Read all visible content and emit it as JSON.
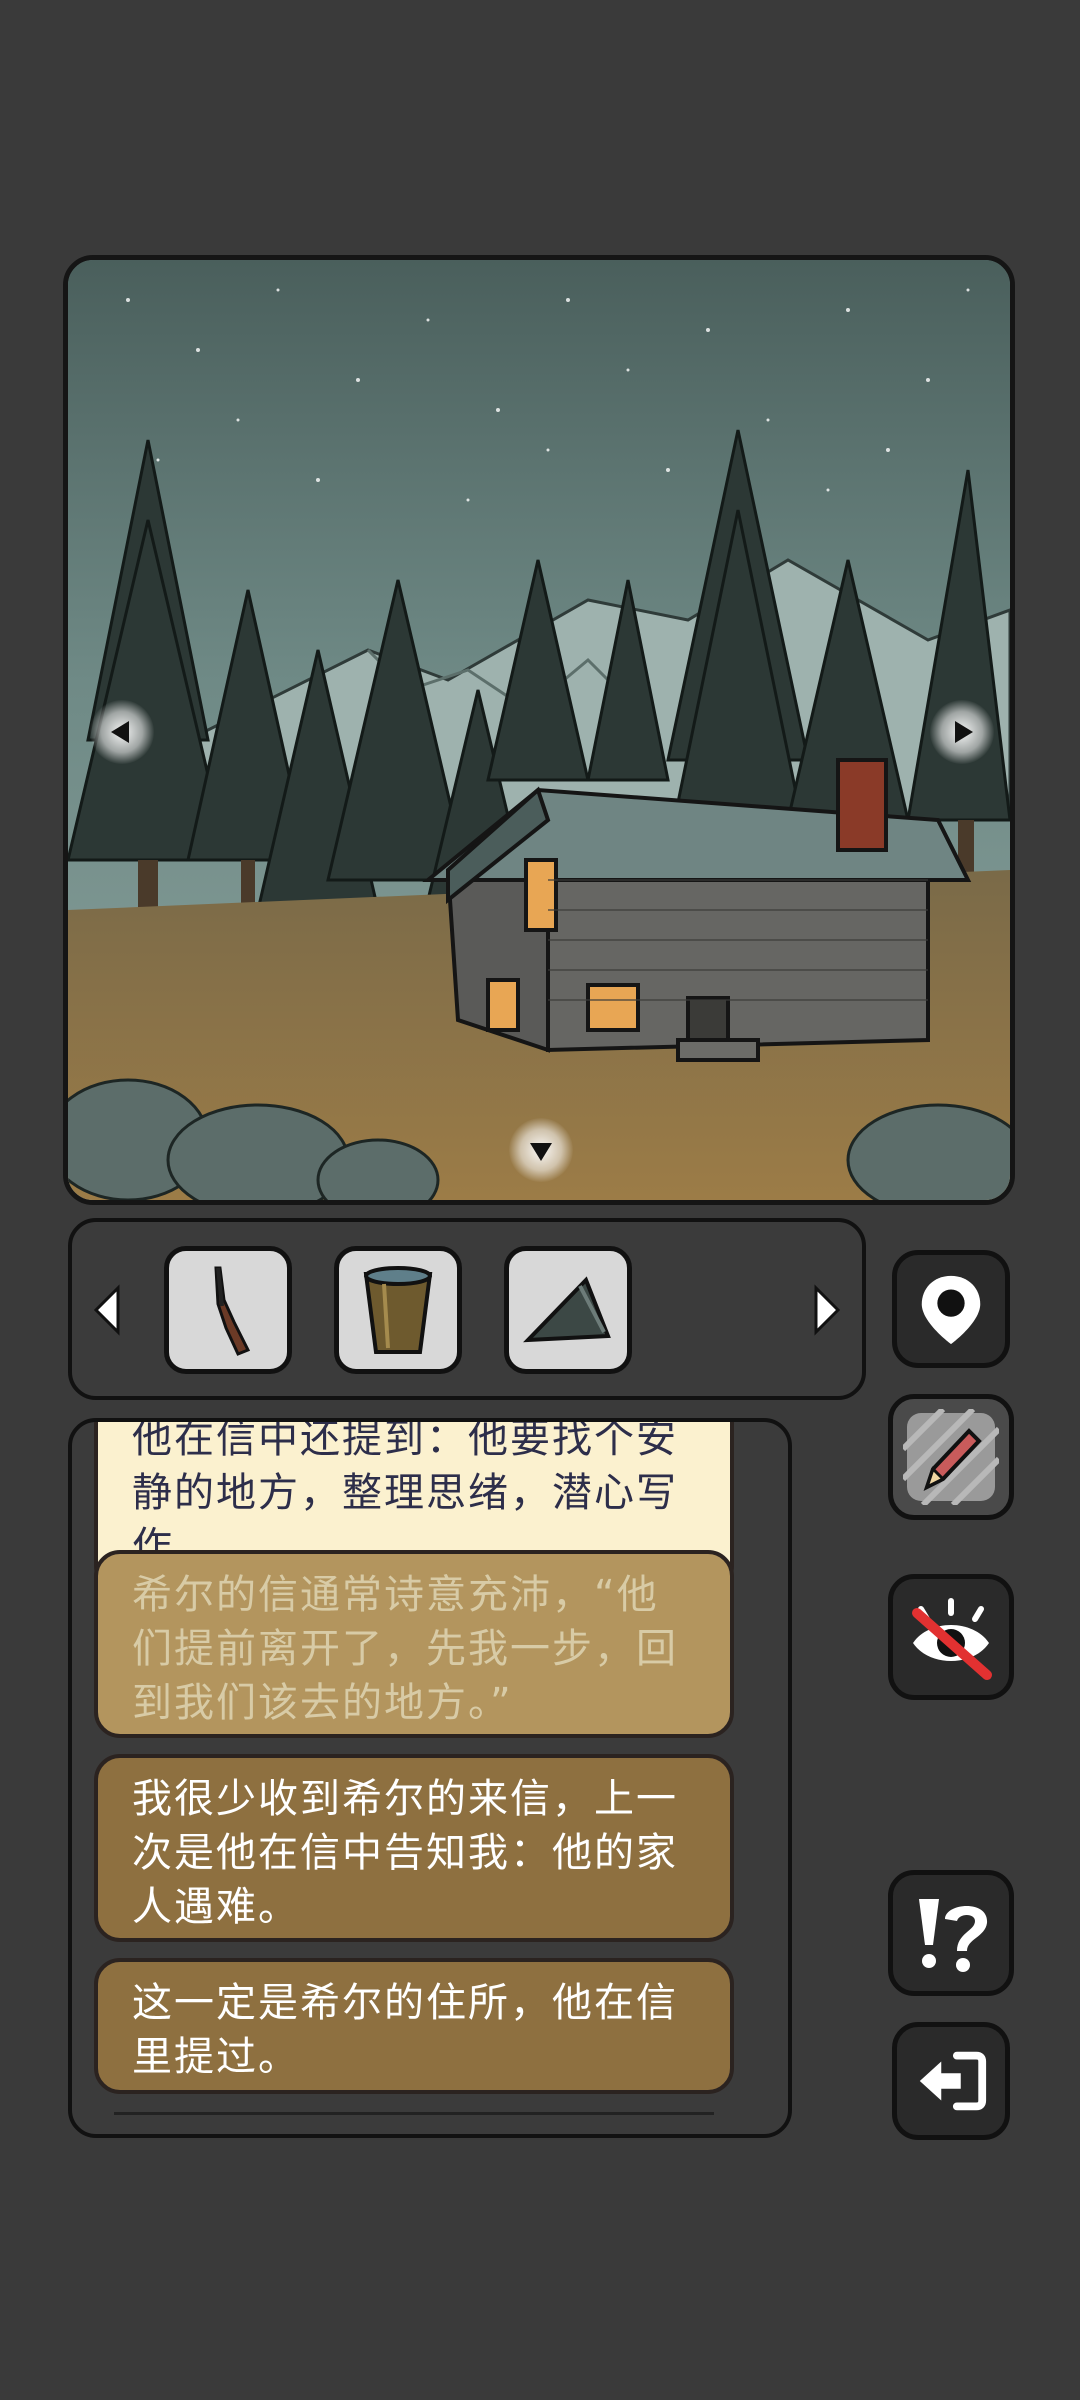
{
  "scene": {
    "nav_left_icon": "triangle-left-icon",
    "nav_right_icon": "triangle-right-icon",
    "nav_down_icon": "triangle-down-icon"
  },
  "inventory": {
    "prev_icon": "chevron-left-icon",
    "next_icon": "chevron-right-icon",
    "items": [
      {
        "icon": "rifle-icon"
      },
      {
        "icon": "bucket-icon"
      },
      {
        "icon": "stone-wedge-icon"
      }
    ]
  },
  "side_buttons": {
    "map": "map-pin-icon",
    "notes": "pencil-icon",
    "hide": "eye-hidden-icon",
    "hint": "hint-icon",
    "exit": "exit-icon"
  },
  "log": {
    "messages": [
      {
        "text": "他在信中还提到：他要找个安静的地方，整理思绪，潜心写作。"
      },
      {
        "text": "希尔的信通常诗意充沛，“他们提前离开了，先我一步，回到我们该去的地方。”"
      },
      {
        "text": "我很少收到希尔的来信，上一次是他在信中告知我：他的家人遇难。"
      },
      {
        "text": "这一定是希尔的住所，他在信里提过。"
      }
    ]
  },
  "colors": {
    "background": "#3a3a3a",
    "panel": "#3b3b3b",
    "slot": "#d8d8d8",
    "msg_new": "#fbf1cf",
    "msg_gold": "#b3955e",
    "msg_brown": "#8e7040"
  }
}
